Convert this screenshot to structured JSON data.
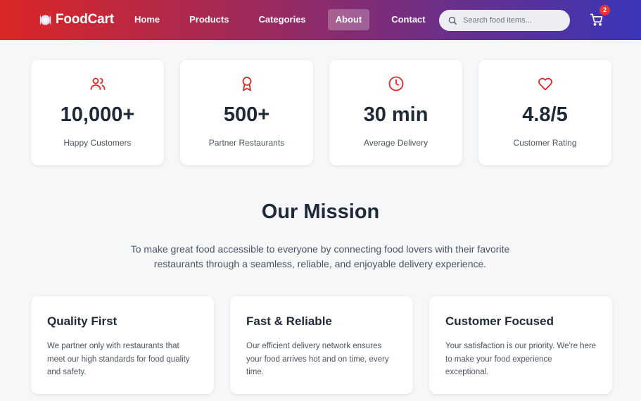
{
  "brand": {
    "name": "FoodCart",
    "icon": "plate-icon"
  },
  "nav": {
    "links": [
      {
        "label": "Home"
      },
      {
        "label": "Products"
      },
      {
        "label": "Categories"
      },
      {
        "label": "About",
        "active": true
      },
      {
        "label": "Contact"
      }
    ]
  },
  "search": {
    "placeholder": "Search food items...",
    "value": ""
  },
  "cart": {
    "count": "2"
  },
  "stats": [
    {
      "icon": "users-icon",
      "value": "10,000+",
      "label": "Happy Customers"
    },
    {
      "icon": "award-icon",
      "value": "500+",
      "label": "Partner Restaurants"
    },
    {
      "icon": "clock-icon",
      "value": "30 min",
      "label": "Average Delivery"
    },
    {
      "icon": "heart-icon",
      "value": "4.8/5",
      "label": "Customer Rating"
    }
  ],
  "mission": {
    "title": "Our Mission",
    "text": "To make great food accessible to everyone by connecting food lovers with their favorite restaurants through a seamless, reliable, and enjoyable delivery experience."
  },
  "features": [
    {
      "title": "Quality First",
      "text": "We partner only with restaurants that meet our high standards for food quality and safety."
    },
    {
      "title": "Fast & Reliable",
      "text": "Our efficient delivery network ensures your food arrives hot and on time, every time."
    },
    {
      "title": "Customer Focused",
      "text": "Your satisfaction is our priority. We're here to make your food experience exceptional."
    }
  ],
  "colors": {
    "accent": "#dc2626",
    "text": "#1f2937",
    "muted": "#4b5563"
  }
}
